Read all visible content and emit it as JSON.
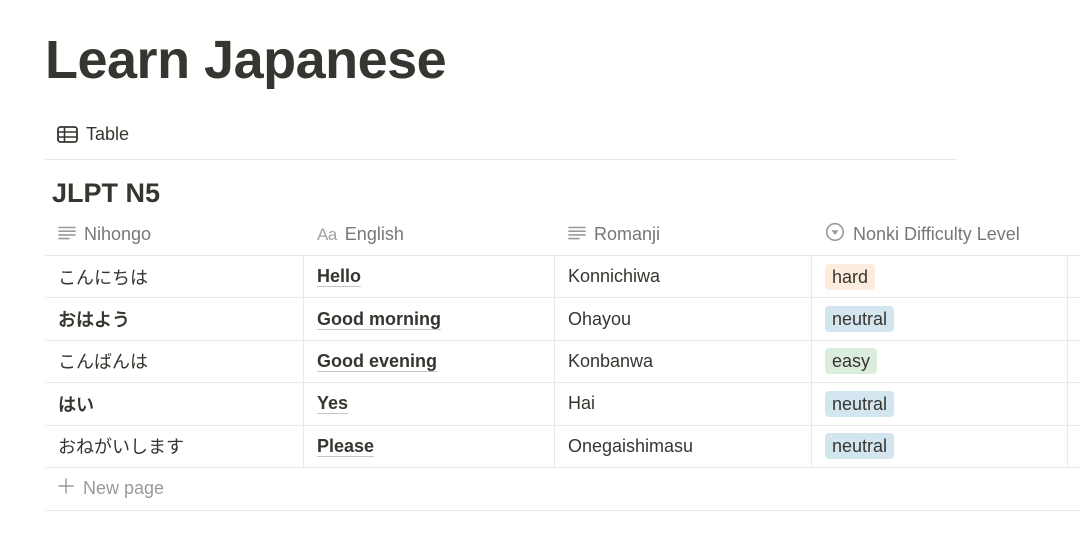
{
  "page": {
    "title": "Learn Japanese"
  },
  "view": {
    "label": "Table",
    "icon": "table-icon"
  },
  "group": {
    "title": "JLPT N5"
  },
  "columns": [
    {
      "label": "Nihongo",
      "icon": "text-lines-icon"
    },
    {
      "label": "English",
      "icon": "title-aa-icon",
      "icon_text": "Aa"
    },
    {
      "label": "Romanji",
      "icon": "text-lines-icon"
    },
    {
      "label": "Nonki Difficulty Level",
      "icon": "select-icon"
    }
  ],
  "rows": [
    {
      "nihongo": "こんにちは",
      "nihongo_bold": false,
      "english": "Hello",
      "romanji": "Konnichiwa",
      "difficulty": "hard"
    },
    {
      "nihongo": "おはよう",
      "nihongo_bold": true,
      "english": "Good morning",
      "romanji": "Ohayou",
      "difficulty": "neutral"
    },
    {
      "nihongo": "こんばんは",
      "nihongo_bold": false,
      "english": "Good evening",
      "romanji": "Konbanwa",
      "difficulty": "easy"
    },
    {
      "nihongo": "はい",
      "nihongo_bold": true,
      "english": "Yes",
      "romanji": "Hai",
      "difficulty": "neutral"
    },
    {
      "nihongo": "おねがいします",
      "nihongo_bold": false,
      "english": "Please",
      "romanji": "Onegaishimasu",
      "difficulty": "neutral"
    }
  ],
  "tag_colors": {
    "hard": "#fbecdd",
    "neutral": "#d3e5ef",
    "easy": "#dbeddb"
  },
  "footer": {
    "new_page_label": "New page",
    "icon": "plus-icon"
  }
}
